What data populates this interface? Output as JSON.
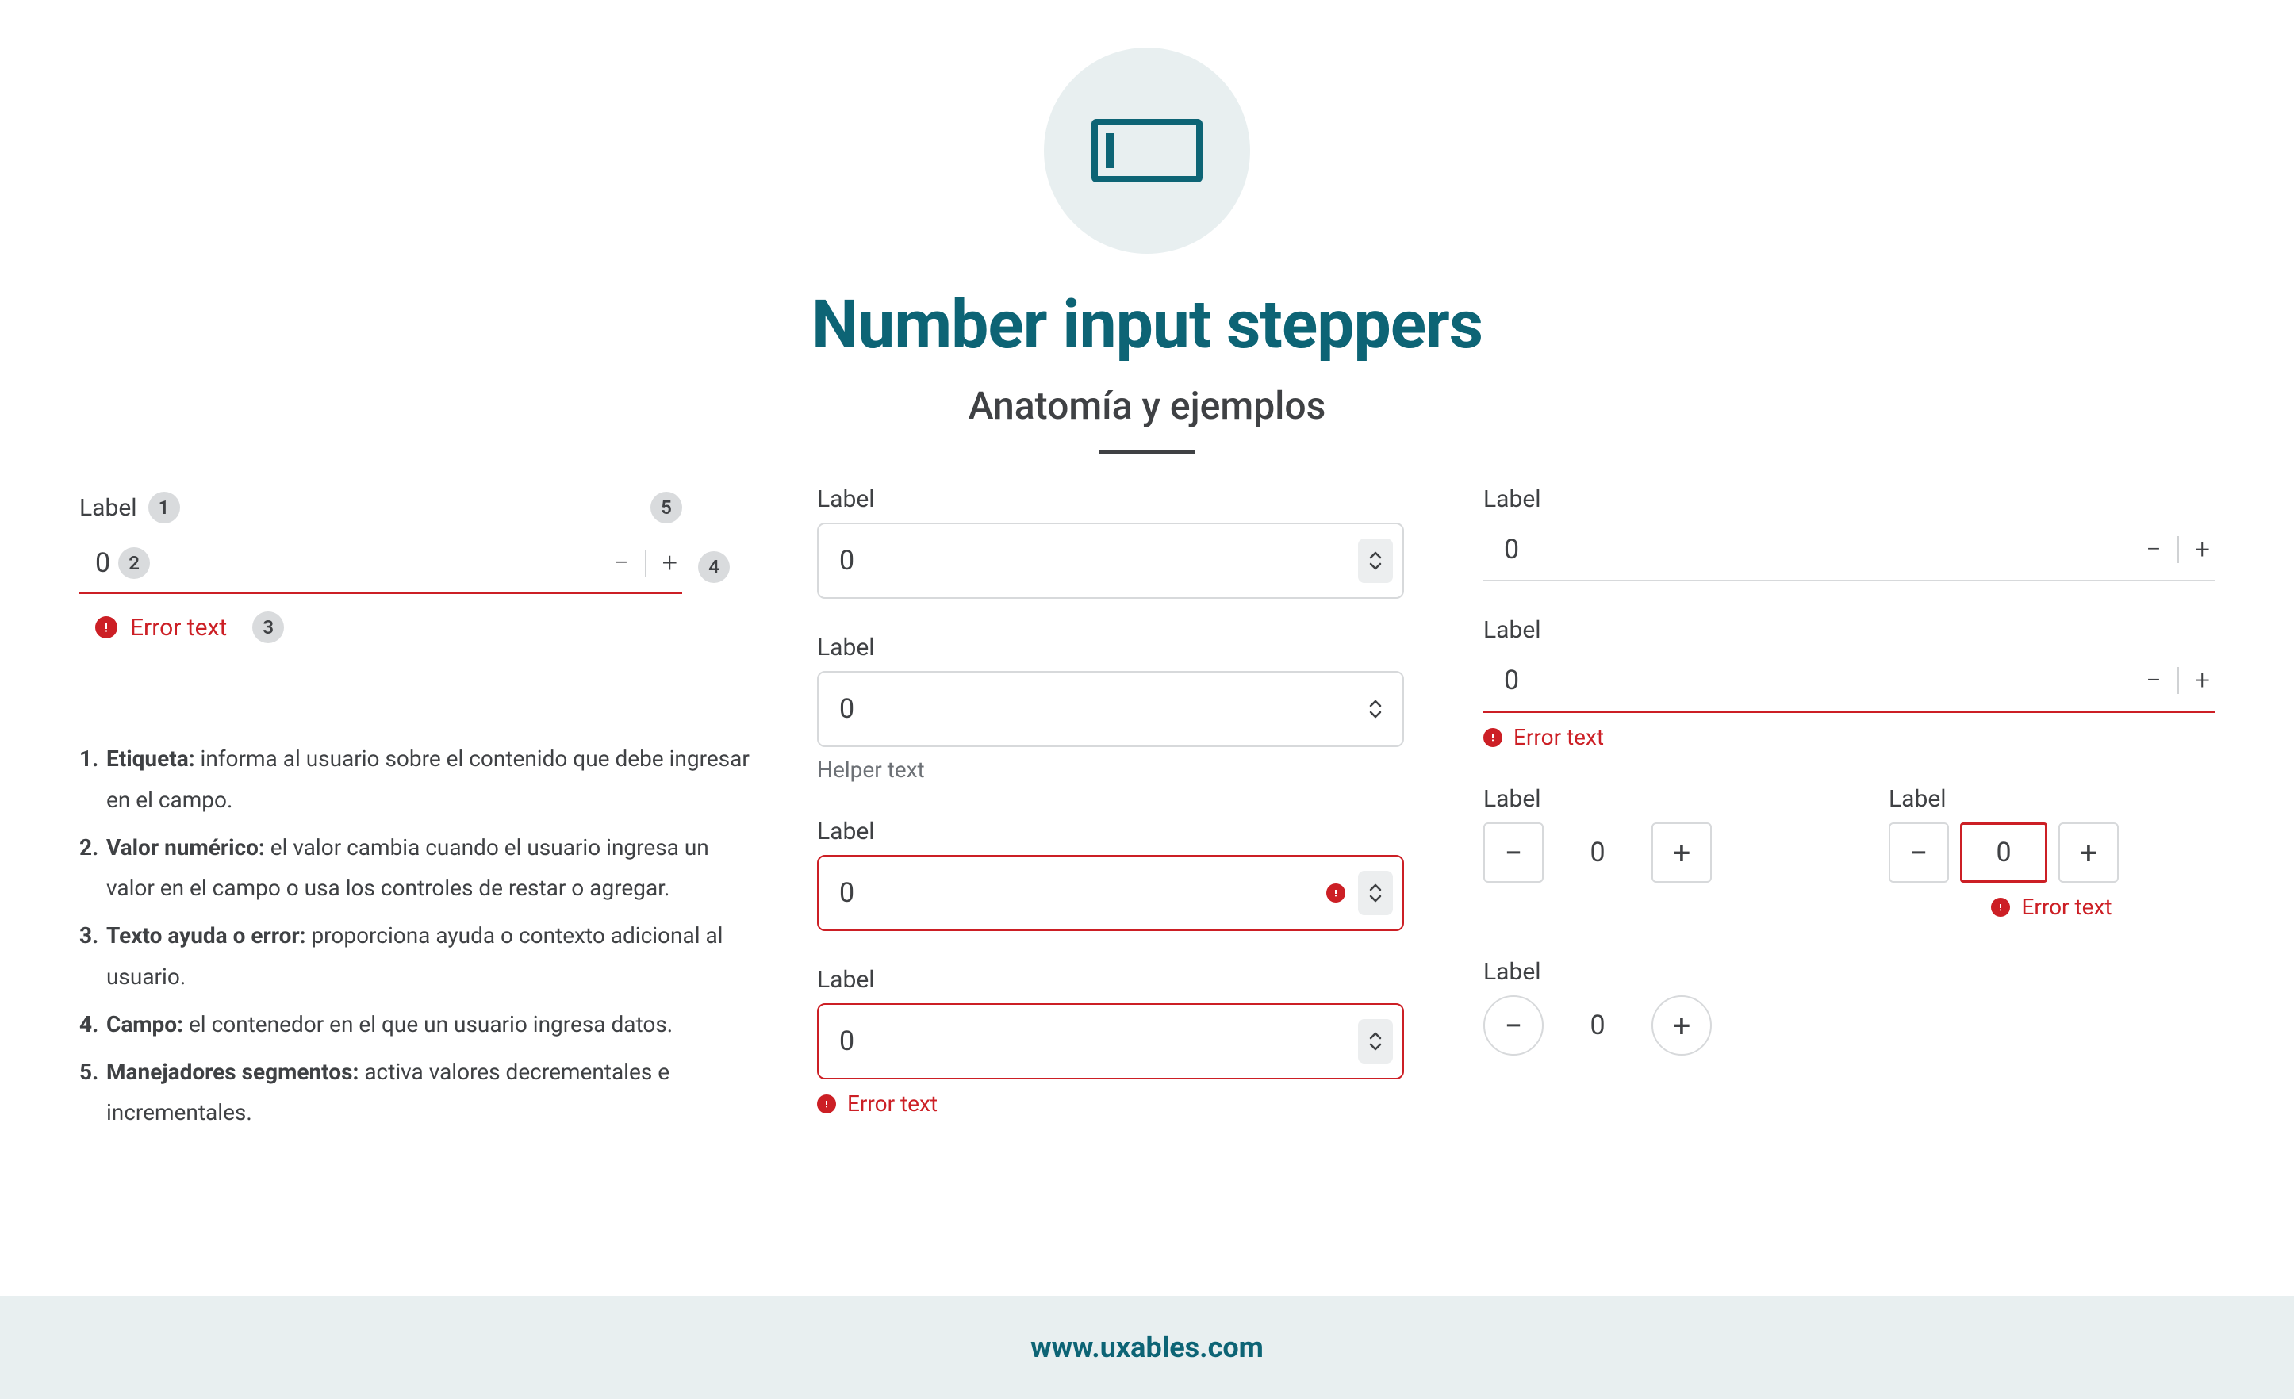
{
  "header": {
    "title": "Number input steppers",
    "subtitle": "Anatomía y ejemplos"
  },
  "anatomy": {
    "label": "Label",
    "value": "0",
    "error_text": "Error text",
    "badges": {
      "b1": "1",
      "b2": "2",
      "b3": "3",
      "b4": "4",
      "b5": "5"
    }
  },
  "definitions": {
    "d1_term": "Etiqueta:",
    "d1_desc": " informa al usuario sobre el contenido que debe ingresar en el campo.",
    "d2_term": "Valor numérico:",
    "d2_desc": " el valor cambia cuando el usuario ingresa un valor en el campo o usa los controles de restar o agregar.",
    "d3_term": "Texto ayuda o error:",
    "d3_desc": " proporciona ayuda o contexto adicional al usuario.",
    "d4_term": "Campo:",
    "d4_desc": " el contenedor en el que un usuario ingresa datos.",
    "d5_term": "Manejadores segmentos:",
    "d5_desc": " activa valores decrementales e incrementales."
  },
  "col2": {
    "f1": {
      "label": "Label",
      "value": "0"
    },
    "f2": {
      "label": "Label",
      "value": "0",
      "helper": "Helper text"
    },
    "f3": {
      "label": "Label",
      "value": "0"
    },
    "f4": {
      "label": "Label",
      "value": "0",
      "error": "Error text"
    }
  },
  "col3": {
    "u1": {
      "label": "Label",
      "value": "0"
    },
    "u2": {
      "label": "Label",
      "value": "0",
      "error": "Error text"
    },
    "sq": {
      "label": "Label",
      "value": "0"
    },
    "sqerr": {
      "label": "Label",
      "value": "0",
      "error": "Error text"
    },
    "circ": {
      "label": "Label",
      "value": "0"
    }
  },
  "footer": {
    "url": "www.uxables.com"
  },
  "glyphs": {
    "minus": "−",
    "plus": "+"
  }
}
